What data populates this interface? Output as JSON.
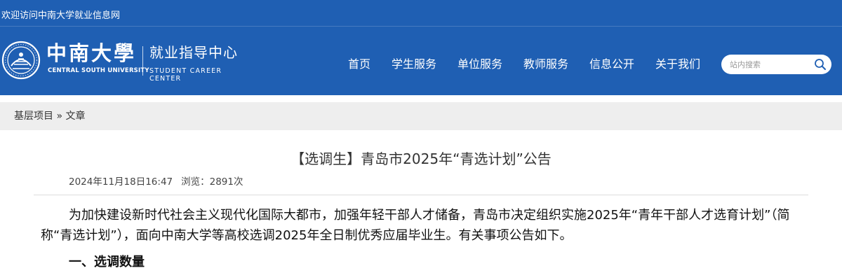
{
  "header": {
    "welcome": "欢迎访问中南大学就业信息网",
    "school_name_cn": "中南大學",
    "school_name_en": "CENTRAL SOUTH UNIVERSITY",
    "center_name_cn": "就业指导中心",
    "center_name_en": "STUDENT CAREER CENTER",
    "colors": {
      "header_bg": "#1f5fb3",
      "text": "#ffffff"
    }
  },
  "nav": {
    "items": [
      {
        "label": "首页"
      },
      {
        "label": "学生服务"
      },
      {
        "label": "单位服务"
      },
      {
        "label": "教师服务"
      },
      {
        "label": "信息公开"
      },
      {
        "label": "关于我们"
      }
    ]
  },
  "search": {
    "placeholder": "站内搜索",
    "value": "",
    "icon": "search-icon"
  },
  "breadcrumb": {
    "items": [
      "基层项目",
      "文章"
    ],
    "separator": "»"
  },
  "article": {
    "title": "【选调生】青岛市2025年“青选计划”公告",
    "date": "2024年11月18日16:47",
    "views": "浏览：2891次",
    "paragraph1": "为加快建设新时代社会主义现代化国际大都市，加强年轻干部人才储备，青岛市决定组织实施2025年“青年干部人才选育计划”（简称“青选计划”），面向中南大学等高校选调2025年全日制优秀应届毕业生。有关事项公告如下。",
    "section1_heading": "一、选调数量"
  }
}
